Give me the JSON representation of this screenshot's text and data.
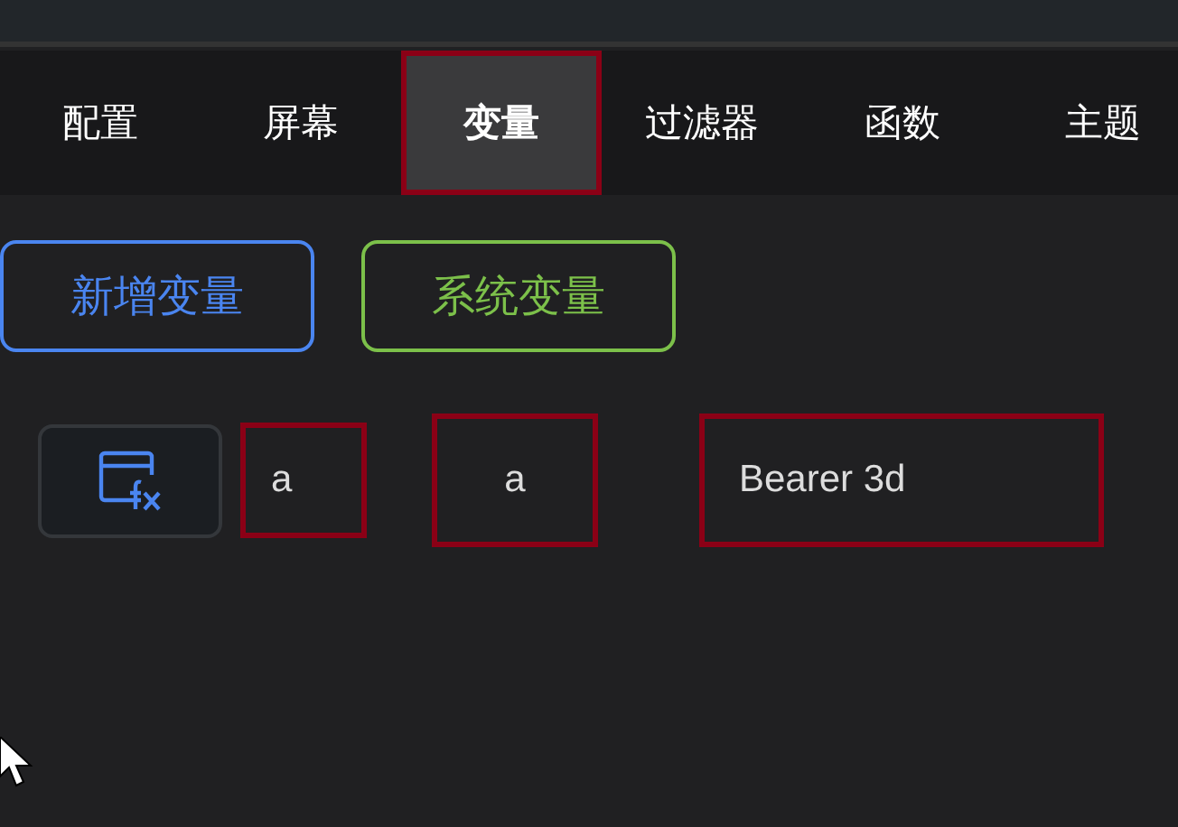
{
  "tabs": [
    {
      "label": "配置",
      "selected": false,
      "highlighted": false
    },
    {
      "label": "屏幕",
      "selected": false,
      "highlighted": false
    },
    {
      "label": "变量",
      "selected": true,
      "highlighted": true
    },
    {
      "label": "过滤器",
      "selected": false,
      "highlighted": false
    },
    {
      "label": "函数",
      "selected": false,
      "highlighted": false
    },
    {
      "label": "主题",
      "selected": false,
      "highlighted": false
    }
  ],
  "buttons": [
    {
      "label": "新增变量",
      "color": "#4a85f0"
    },
    {
      "label": "系统变量",
      "color": "#7cc04a"
    }
  ],
  "variable_row": {
    "cells": [
      {
        "text": "a",
        "highlighted": true
      },
      {
        "text": "a",
        "highlighted": true
      },
      {
        "text": "Bearer 3d",
        "highlighted": true
      }
    ]
  }
}
